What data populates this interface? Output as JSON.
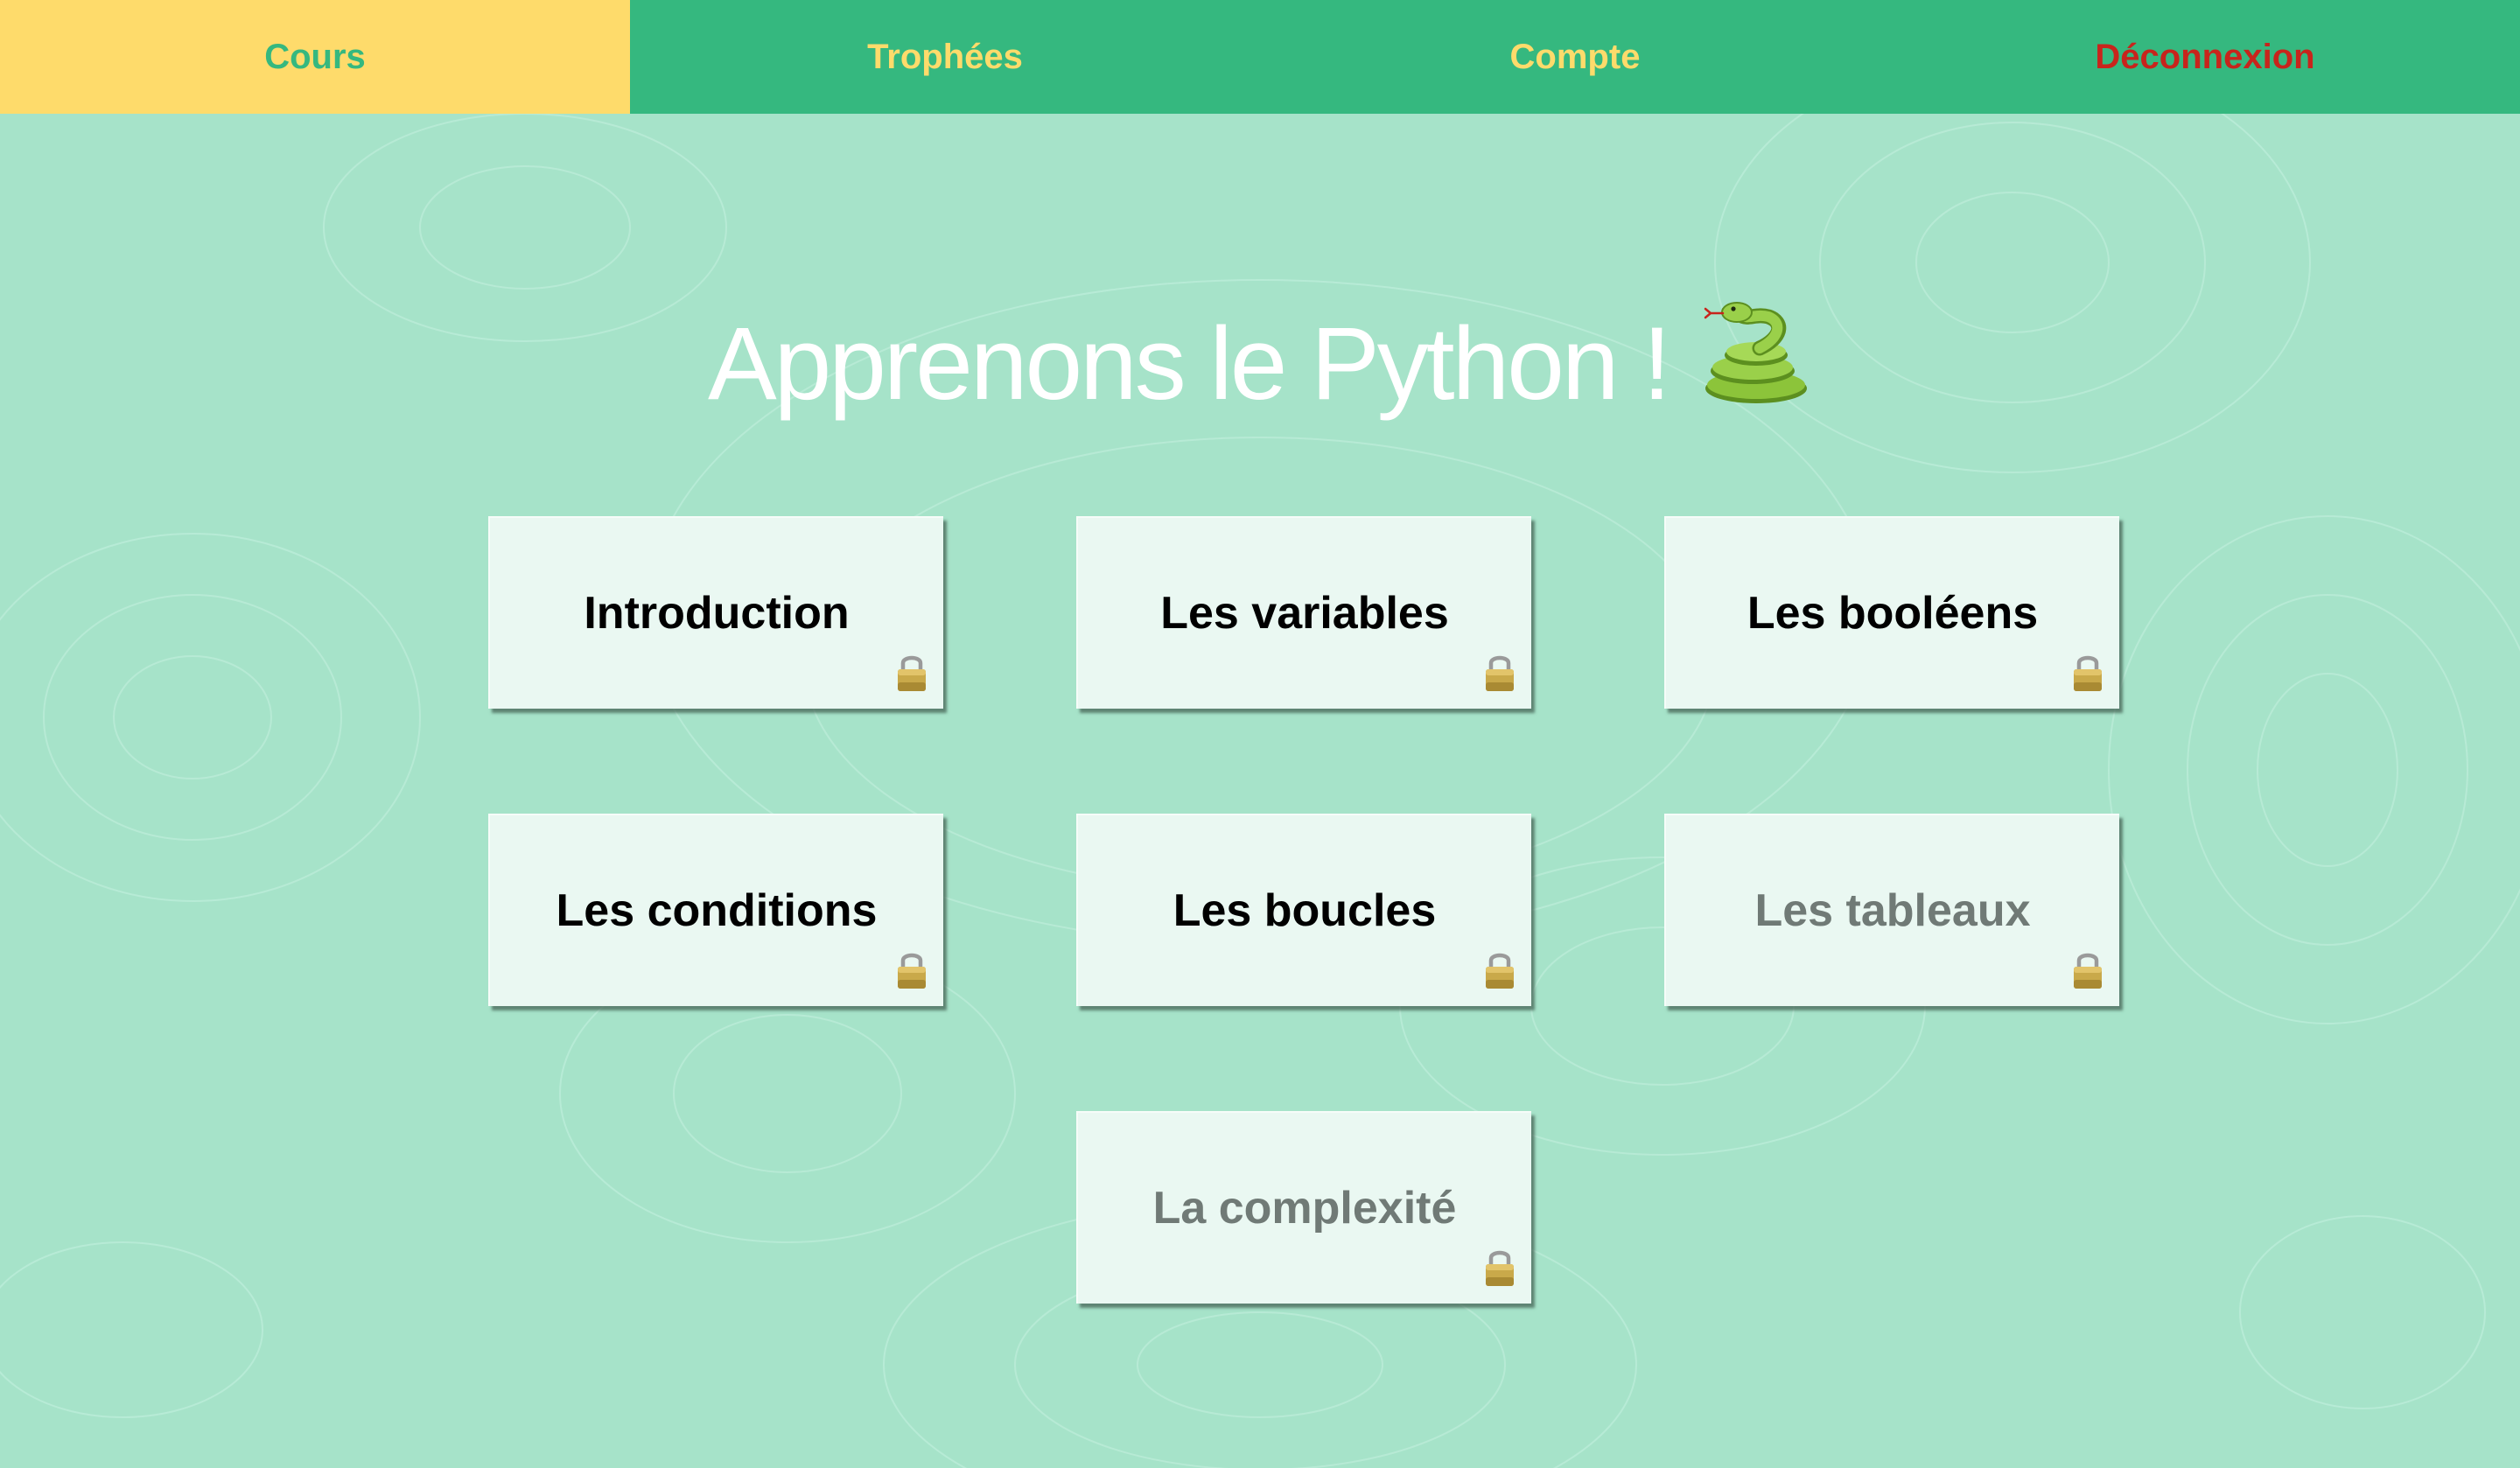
{
  "colors": {
    "background": "#a6e3c9",
    "navbar": "#35b87f",
    "nav_active": "#fedb6b",
    "nav_text": "#fedb6b",
    "logout_text": "#c8241c",
    "card": "#eaf8f2",
    "locked_text": "#707a76"
  },
  "nav": {
    "items": [
      {
        "label": "Cours",
        "active": true
      },
      {
        "label": "Trophées",
        "active": false
      },
      {
        "label": "Compte",
        "active": false
      },
      {
        "label": "Déconnexion",
        "active": false
      }
    ]
  },
  "page": {
    "title": "Apprenons le Python !",
    "title_icon": "snake-icon"
  },
  "courses": [
    {
      "label": "Introduction",
      "available": true,
      "icon": "lock-icon"
    },
    {
      "label": "Les variables",
      "available": true,
      "icon": "lock-icon"
    },
    {
      "label": "Les booléens",
      "available": true,
      "icon": "lock-icon"
    },
    {
      "label": "Les conditions",
      "available": true,
      "icon": "lock-icon"
    },
    {
      "label": "Les boucles",
      "available": true,
      "icon": "lock-icon"
    },
    {
      "label": "Les tableaux",
      "available": false,
      "icon": "lock-icon"
    },
    {
      "label": "La complexité",
      "available": false,
      "icon": "lock-icon"
    }
  ]
}
